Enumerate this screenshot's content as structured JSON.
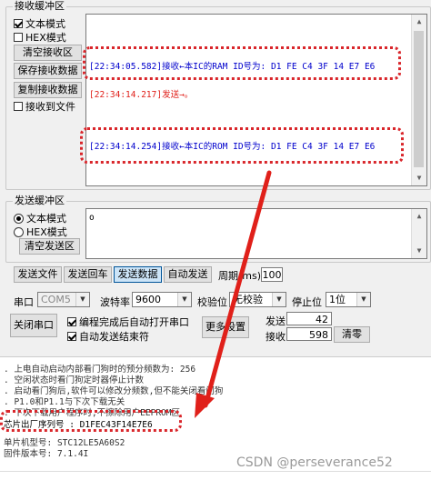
{
  "receive_group": {
    "title": "接收缓冲区",
    "mode_text": "文本模式",
    "mode_hex": "HEX模式",
    "clear_btn": "清空接收区",
    "save_btn": "保存接收数据",
    "copy_btn": "复制接收数据",
    "save_to_file": "接收到文件",
    "log": [
      {
        "text": "[22:34:05.582]接收←本IC的RAM ID号为: D1 FE C4 3F 14 E7 E6",
        "color": "#0000cc"
      },
      {
        "text": "[22:34:14.217]发送→。",
        "color": "#e0201a"
      },
      {
        "text": "[22:34:14.254]接收←本IC的ROM ID号为: D1 FE C4 3F 14 E7 E6",
        "color": "#0000cc"
      }
    ]
  },
  "send_group": {
    "title": "发送缓冲区",
    "mode_text": "文本模式",
    "mode_hex": "HEX模式",
    "clear_btn": "清空发送区",
    "content": "o"
  },
  "send_buttons": {
    "send_file": "发送文件",
    "send_enter": "发送回车",
    "send_data": "发送数据",
    "auto_send": "自动发送",
    "period_label": "周期(ms)",
    "period_value": "100"
  },
  "settings": {
    "port_label": "串口",
    "port_value": "COM5",
    "baud_label": "波特率",
    "baud_value": "9600",
    "parity_label": "校验位",
    "parity_value": "无校验",
    "stop_label": "停止位",
    "stop_value": "1位",
    "close_port_btn": "关闭串口",
    "auto_open_chk": "编程完成后自动打开串口",
    "auto_send_end_chk": "自动发送结束符",
    "more_settings_btn": "更多设置",
    "send_count_label": "发送",
    "send_count": "42",
    "recv_count_label": "接收",
    "recv_count": "598",
    "clear_btn": "清零"
  },
  "console": {
    "lines": [
      ". 上电自动启动内部看门狗时的预分频数为: 256",
      ". 空闲状态时看门狗定时器停止计数",
      ". 启动看门狗后,软件可以修改分频数,但不能关闭看门狗",
      ". P1.0和P1.1与下次下载无关",
      ". 下次下载用户程序时,不擦除用户EEPROM区",
      "芯片出厂序列号 : D1FEC43F14E7E6",
      "单片机型号: STC12LE5A60S2",
      "固件版本号: 7.1.4I"
    ]
  },
  "watermark": "CSDN @perseverance52"
}
